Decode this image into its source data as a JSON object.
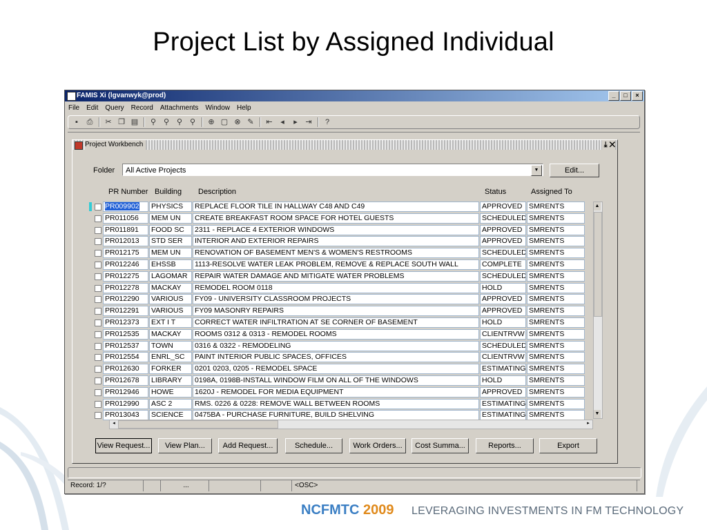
{
  "slide_title": "Project List by Assigned Individual",
  "window": {
    "title": "FAMIS Xi (lgvanwyk@prod)",
    "controls": [
      "_",
      "□",
      "×"
    ]
  },
  "menu": [
    "File",
    "Edit",
    "Query",
    "Record",
    "Attachments",
    "Window",
    "Help"
  ],
  "toolbar_icons": [
    "save-icon",
    "print-icon",
    "cut-icon",
    "copy-icon",
    "paste-icon",
    "query-enter-icon",
    "query-execute-icon",
    "query-count-icon",
    "query-cancel-icon",
    "record-insert-icon",
    "record-clear-icon",
    "record-delete-icon",
    "record-edit-icon",
    "first-record-icon",
    "previous-record-icon",
    "next-record-icon",
    "last-record-icon",
    "help-icon"
  ],
  "workbench": {
    "title": "Project Workbench",
    "folder_label": "Folder",
    "folder_value": "All Active Projects",
    "edit_label": "Edit...",
    "columns": [
      "PR Number",
      "Building",
      "Description",
      "Status",
      "Assigned To"
    ],
    "rows": [
      [
        "PR009902",
        "PHYSICS",
        "REPLACE FLOOR TILE IN HALLWAY C48 AND C49",
        "APPROVED",
        "SMRENTS"
      ],
      [
        "PR011056",
        "MEM UN",
        "CREATE BREAKFAST ROOM SPACE FOR HOTEL GUESTS",
        "SCHEDULED",
        "SMRENTS"
      ],
      [
        "PR011891",
        "FOOD SC",
        "2311 - REPLACE 4 EXTERIOR WINDOWS",
        "APPROVED",
        "SMRENTS"
      ],
      [
        "PR012013",
        "STD SER",
        "INTERIOR AND EXTERIOR REPAIRS",
        "APPROVED",
        "SMRENTS"
      ],
      [
        "PR012175",
        "MEM UN",
        "RENOVATION OF BASEMENT MEN'S & WOMEN'S RESTROOMS",
        "SCHEDULED",
        "SMRENTS"
      ],
      [
        "PR012246",
        "EHSSB",
        "1113-RESOLVE WATER LEAK PROBLEM, REMOVE & REPLACE SOUTH WALL",
        "COMPLETE",
        "SMRENTS"
      ],
      [
        "PR012275",
        "LAGOMAR",
        "REPAIR WATER DAMAGE AND MITIGATE WATER PROBLEMS",
        "SCHEDULED",
        "SMRENTS"
      ],
      [
        "PR012278",
        "MACKAY",
        "REMODEL ROOM 0118",
        "HOLD",
        "SMRENTS"
      ],
      [
        "PR012290",
        "VARIOUS",
        "FY09 - UNIVERSITY CLASSROOM PROJECTS",
        "APPROVED",
        "SMRENTS"
      ],
      [
        "PR012291",
        "VARIOUS",
        "FY09 MASONRY REPAIRS",
        "APPROVED",
        "SMRENTS"
      ],
      [
        "PR012373",
        "EXT I T",
        "CORRECT WATER INFILTRATION AT SE CORNER OF BASEMENT",
        "HOLD",
        "SMRENTS"
      ],
      [
        "PR012535",
        "MACKAY",
        "ROOMS 0312 & 0313 - REMODEL ROOMS",
        "CLIENTRVW",
        "SMRENTS"
      ],
      [
        "PR012537",
        "TOWN",
        "0316 & 0322 - REMODELING",
        "SCHEDULED",
        "SMRENTS"
      ],
      [
        "PR012554",
        "ENRL_SC",
        "PAINT INTERIOR PUBLIC SPACES, OFFICES",
        "CLIENTRVW",
        "SMRENTS"
      ],
      [
        "PR012630",
        "FORKER",
        "0201 0203, 0205 - REMODEL SPACE",
        "ESTIMATING",
        "SMRENTS"
      ],
      [
        "PR012678",
        "LIBRARY",
        "0198A, 0198B-INSTALL WINDOW FILM ON ALL OF THE WINDOWS",
        "HOLD",
        "SMRENTS"
      ],
      [
        "PR012946",
        "HOWE",
        "1620J - REMODEL FOR MEDIA EQUIPMENT",
        "APPROVED",
        "SMRENTS"
      ],
      [
        "PR012990",
        "ASC 2",
        "RMS. 0226 & 0228: REMOVE WALL BETWEEN ROOMS",
        "ESTIMATING",
        "SMRENTS"
      ],
      [
        "PR013043",
        "SCIENCE",
        "0475BA - PURCHASE FURNITURE, BUILD SHELVING",
        "ESTIMATING",
        "SMRENTS"
      ]
    ],
    "buttons": [
      "View Request...",
      "View Plan...",
      "Add Request...",
      "Schedule...",
      "Work Orders...",
      "Cost Summa...",
      "Reports...",
      "Export"
    ]
  },
  "statusbar": {
    "record": "Record: 1/?",
    "ellipsis": "...",
    "mode": "<OSC>"
  },
  "footer": {
    "brand": "NCFMTC",
    "year": "2009",
    "tagline": "LEVERAGING INVESTMENTS IN FM TECHNOLOGY"
  },
  "colors": {
    "selection": "#1f5fd6",
    "cell_border": "#9fb5cc",
    "current_row_marker": "#33ccd6",
    "brand_blue": "#3b7fc4",
    "brand_orange": "#e08a1c"
  }
}
